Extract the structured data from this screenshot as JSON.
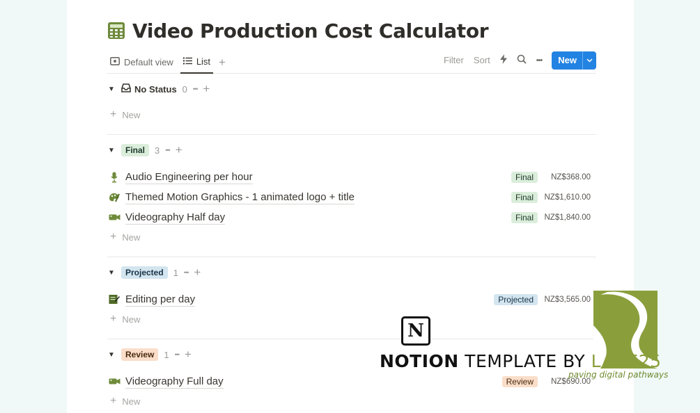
{
  "page": {
    "title": "Video Production Cost Calculator",
    "title_icon": "abacus-icon"
  },
  "views": {
    "tabs": [
      {
        "label": "Default view",
        "icon": "table-icon"
      },
      {
        "label": "List",
        "icon": "list-icon",
        "active": true
      }
    ],
    "add_view": "+"
  },
  "toolbar": {
    "filter": "Filter",
    "sort": "Sort",
    "automation_icon": "lightning-icon",
    "search_icon": "search-icon",
    "more": "•••",
    "new_label": "New",
    "new_menu_icon": "chevron-down-icon"
  },
  "groups": [
    {
      "name": "No Status",
      "count": "0",
      "style": "plain",
      "icon": "inbox-icon",
      "rows": [],
      "new_label": "New"
    },
    {
      "name": "Final",
      "count": "3",
      "style": "final",
      "new_label": "New",
      "rows": [
        {
          "name": "Audio Engineering per hour",
          "icon": "microphone-icon",
          "status": "Final",
          "price": "NZ$368.00"
        },
        {
          "name": "Themed Motion Graphics - 1 animated logo + title",
          "icon": "palette-icon",
          "status": "Final",
          "price": "NZ$1,610.00"
        },
        {
          "name": "Videography Half day",
          "icon": "video-camera-icon",
          "status": "Final",
          "price": "NZ$1,840.00"
        }
      ]
    },
    {
      "name": "Projected",
      "count": "1",
      "style": "projected",
      "new_label": "New",
      "rows": [
        {
          "name": "Editing per day",
          "icon": "memo-icon",
          "status": "Projected",
          "price": "NZ$3,565.00"
        }
      ]
    },
    {
      "name": "Review",
      "count": "1",
      "style": "review",
      "new_label": "New",
      "rows": [
        {
          "name": "Videography Full day",
          "icon": "video-camera-icon",
          "status": "Review",
          "price": "NZ$690.00"
        }
      ]
    }
  ],
  "group_actions": {
    "dots": "•••",
    "plus": "+",
    "new_plus": "+"
  },
  "watermark": {
    "logo_letter": "N",
    "word_notion": "NOTION",
    "word_template": "TEMPLATE",
    "word_by": "BY",
    "brand": "LANE25",
    "tagline": "paving digital pathways"
  },
  "colors": {
    "accent": "#2383e2",
    "final_bg": "#dbeddb",
    "projected_bg": "#d3e5ef",
    "review_bg": "#fadec9",
    "brand_green": "#8a9f3c"
  }
}
